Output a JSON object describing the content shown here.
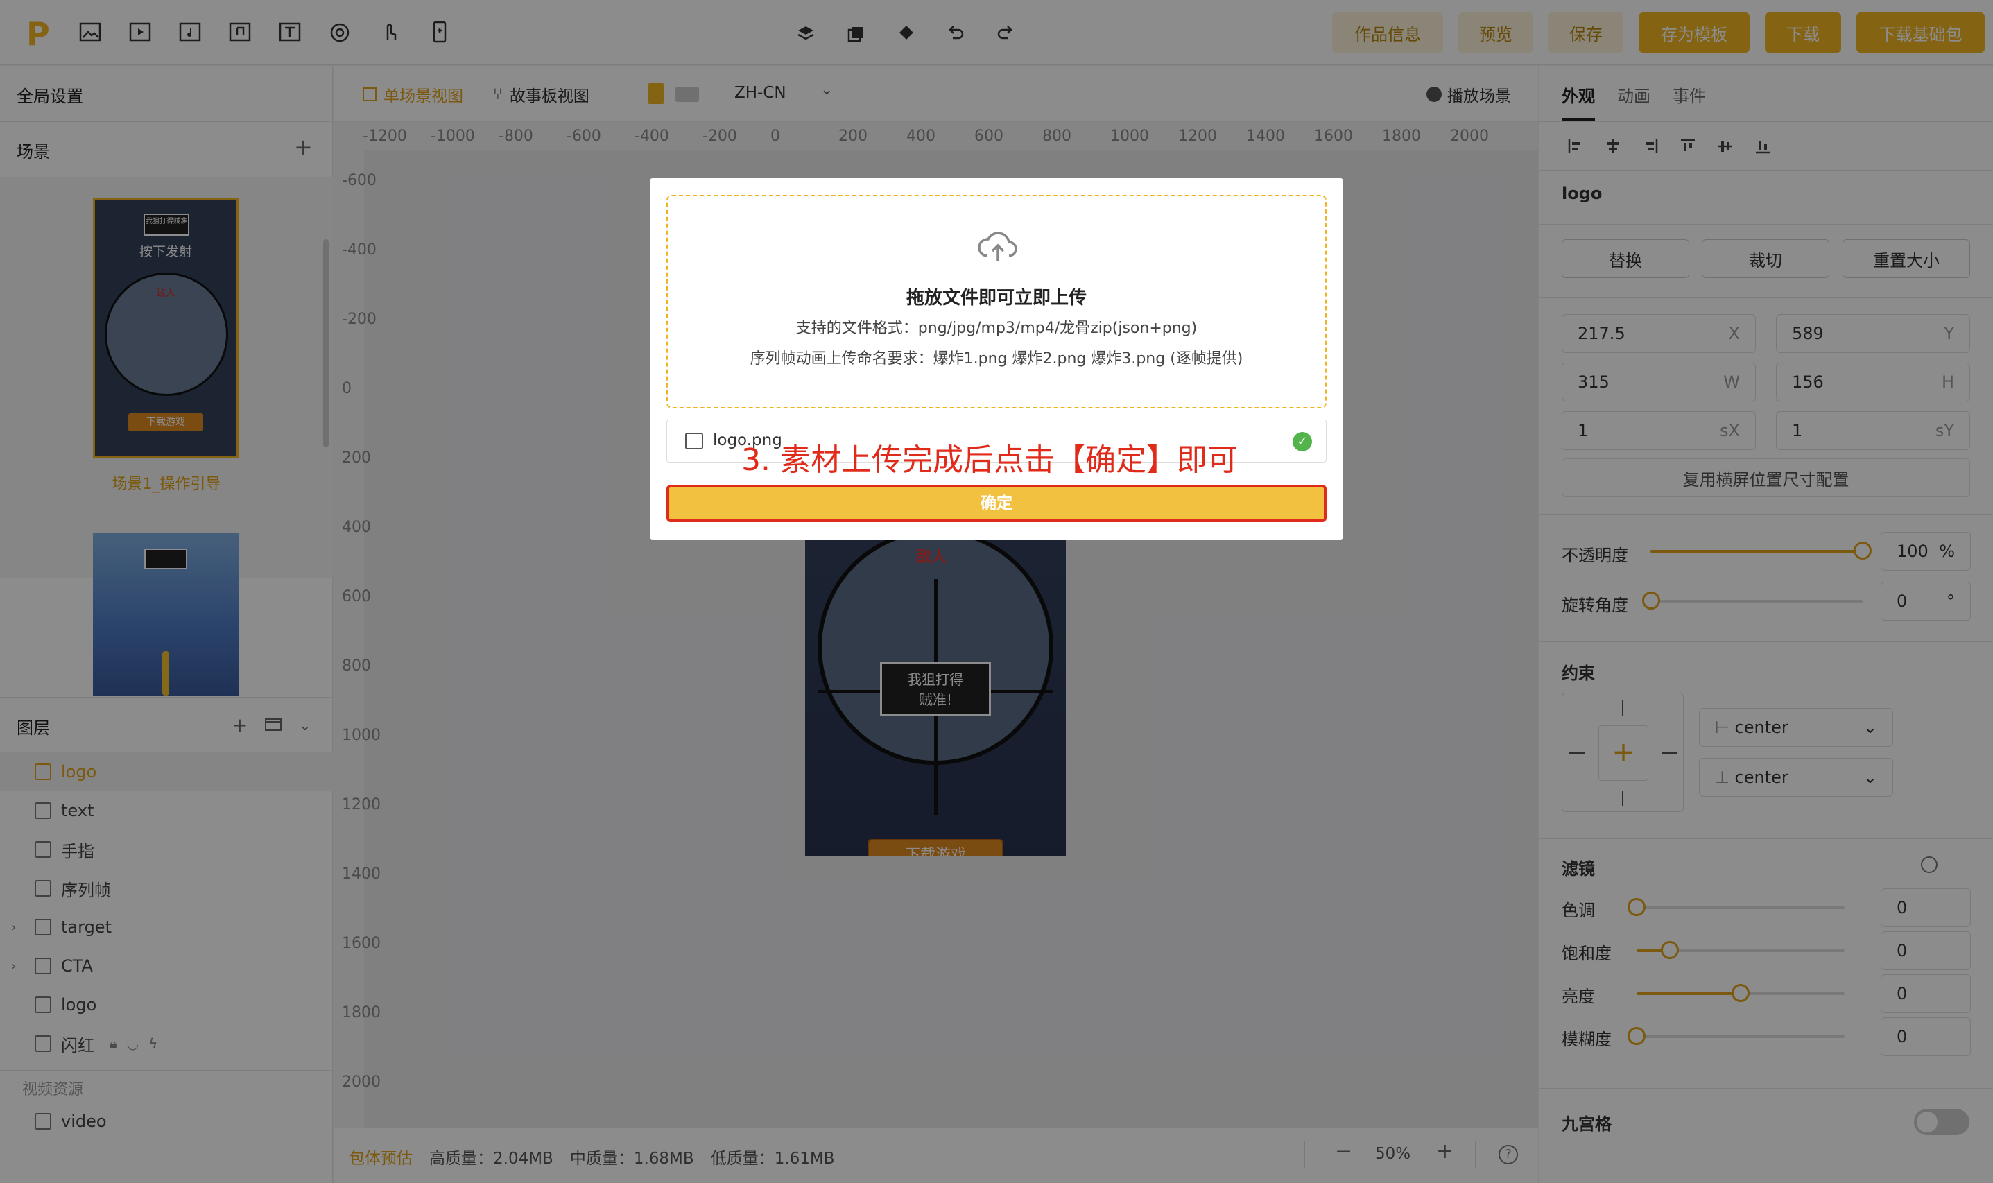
{
  "toolbar": {
    "save_info": "作品信息",
    "preview": "预览",
    "save": "保存",
    "save_template": "存为模板",
    "download": "下载",
    "download_base": "下载基础包"
  },
  "left": {
    "global": "全局设置",
    "scenes_title": "场景",
    "scene1": {
      "label": "场景1_操作引导",
      "badge": "我狙打得贼准",
      "press": "按下发射",
      "enemy": "敌人",
      "cta": "下载游戏"
    },
    "layers_title": "图层",
    "layers": [
      "logo",
      "text",
      "手指",
      "序列帧",
      "target",
      "CTA",
      "logo",
      "闪红"
    ],
    "video_res": "视频资源",
    "video": "video"
  },
  "center": {
    "tab_single": "单场景视图",
    "tab_story": "故事板视图",
    "lang": "ZH-CN",
    "play": "播放场景",
    "ruler_x": [
      "-1200",
      "-1000",
      "-800",
      "-600",
      "-400",
      "-200",
      "0",
      "200",
      "400",
      "600",
      "800",
      "1000",
      "1200",
      "1400",
      "1600",
      "1800",
      "2000"
    ],
    "ruler_y": [
      "-600",
      "-400",
      "-200",
      "0",
      "200",
      "400",
      "600",
      "800",
      "1000",
      "1200",
      "1400",
      "1600",
      "1800",
      "2000"
    ],
    "canvas": {
      "enemy": "敌人",
      "badge_line1": "我狙打得",
      "badge_line2": "贼准!",
      "cta": "下载游戏"
    },
    "footer": {
      "estimate": "包体预估",
      "high": "高质量：2.04MB",
      "mid": "中质量：1.68MB",
      "low": "低质量：1.61MB",
      "zoom": "50%"
    }
  },
  "right": {
    "tabs": [
      "外观",
      "动画",
      "事件"
    ],
    "name": "logo",
    "btn_replace": "替换",
    "btn_crop": "裁切",
    "btn_resize": "重置大小",
    "x": "217.5",
    "y": "589",
    "w": "315",
    "h": "156",
    "sx": "1",
    "sy": "1",
    "x_u": "X",
    "y_u": "Y",
    "w_u": "W",
    "h_u": "H",
    "sx_u": "sX",
    "sy_u": "sY",
    "reuse": "复用横屏位置尺寸配置",
    "opacity_label": "不透明度",
    "opacity": "100",
    "opacity_unit": "%",
    "rotate_label": "旋转角度",
    "rotate": "0",
    "rotate_unit": "°",
    "constraint": "约束",
    "h_align": "center",
    "v_align": "center",
    "filter": "滤镜",
    "filters": [
      {
        "label": "色调",
        "value": "0",
        "level": 0.0
      },
      {
        "label": "饱和度",
        "value": "0",
        "level": 0.16
      },
      {
        "label": "亮度",
        "value": "0",
        "level": 0.5
      },
      {
        "label": "模糊度",
        "value": "0",
        "level": 0.0
      }
    ],
    "nine": "九宫格"
  },
  "modal": {
    "title": "拖放文件即可立即上传",
    "formats": "支持的文件格式：png/jpg/mp3/mp4/龙骨zip(json+png)",
    "seq": "序列帧动画上传命名要求：爆炸1.png 爆炸2.png 爆炸3.png (逐帧提供)",
    "file": "logo.png",
    "annotation": "3. 素材上传完成后点击【确定】即可",
    "confirm": "确定"
  },
  "colors": {
    "accent": "#f0b423",
    "annot": "#e02a1a"
  }
}
